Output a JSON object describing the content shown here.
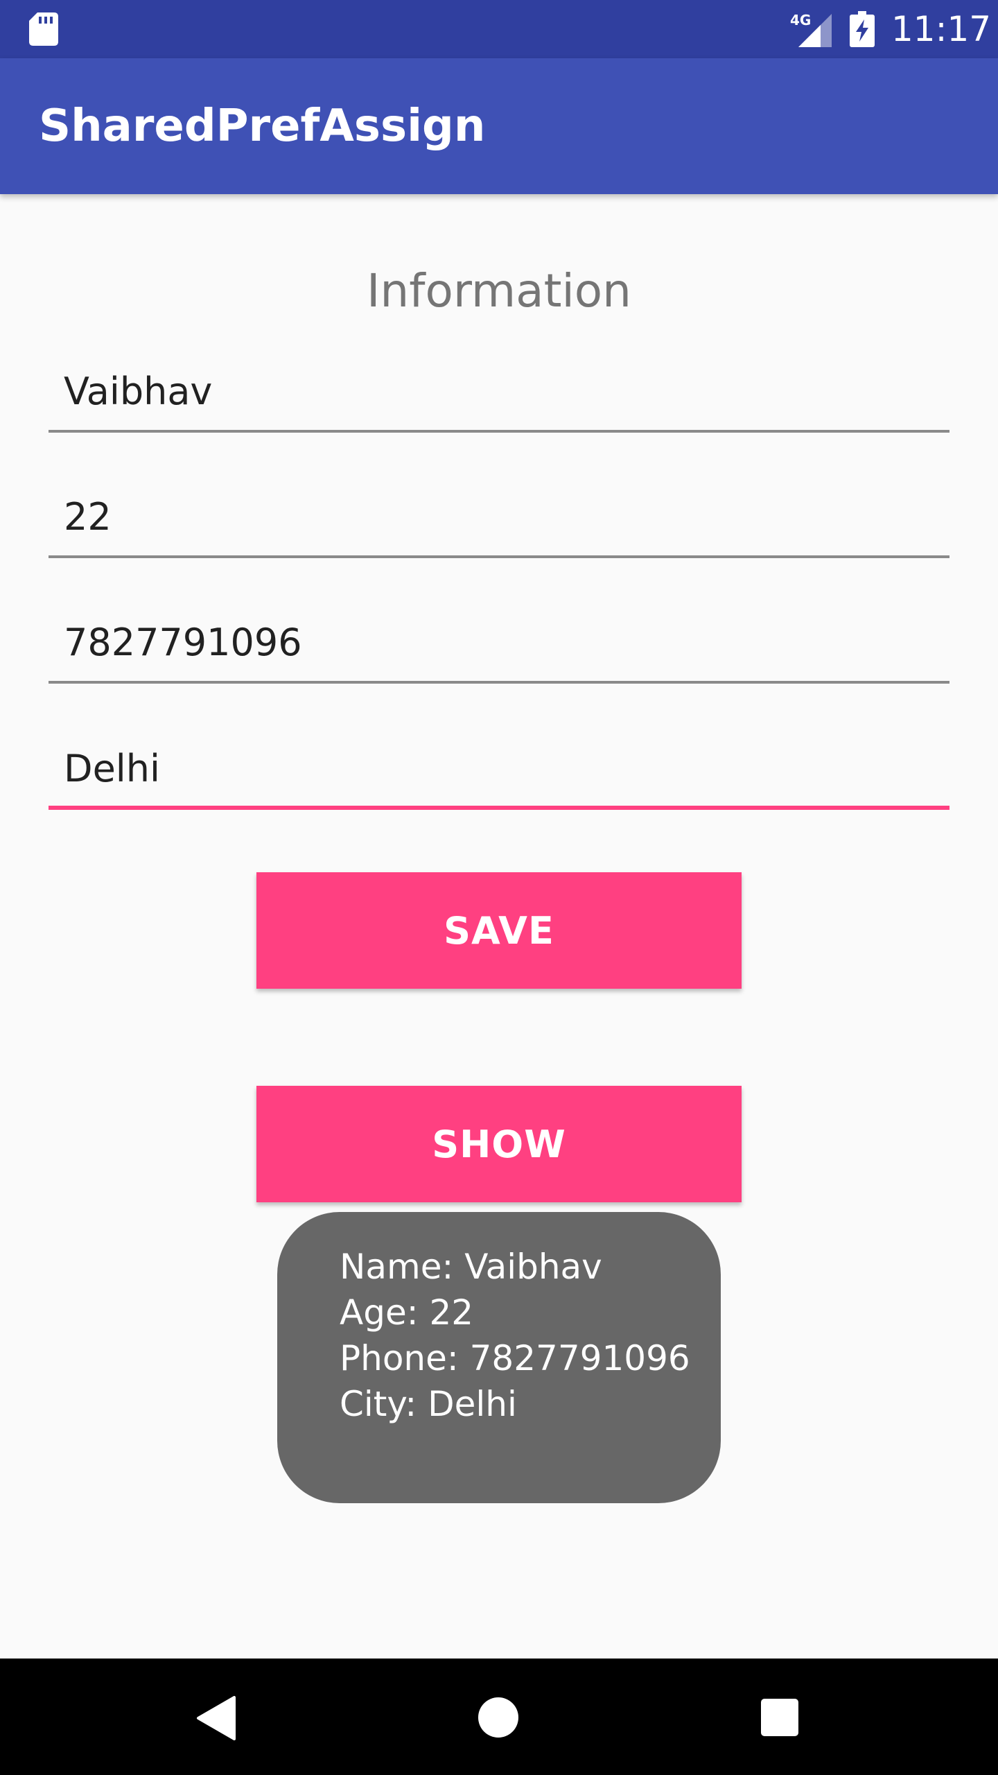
{
  "status_bar": {
    "network": "4G",
    "time": "11:17",
    "icons": [
      "sd-card-icon",
      "signal-icon",
      "battery-charging-icon"
    ]
  },
  "app_bar": {
    "title": "SharedPrefAssign",
    "color": "#3f51b5",
    "status_color": "#303f9f"
  },
  "form": {
    "heading": "Information",
    "fields": [
      {
        "value": "Vaibhav"
      },
      {
        "value": "22"
      },
      {
        "value": "7827791096"
      },
      {
        "value": "Delhi",
        "focused": true
      }
    ],
    "accent": "#ff4081"
  },
  "buttons": {
    "save": "SAVE",
    "show": "SHOW"
  },
  "toast": {
    "lines": [
      "Name: Vaibhav",
      "Age: 22",
      "Phone: 7827791096",
      "City: Delhi"
    ]
  },
  "nav_bar": {
    "icons": [
      "back-icon",
      "home-icon",
      "recent-apps-icon"
    ]
  }
}
